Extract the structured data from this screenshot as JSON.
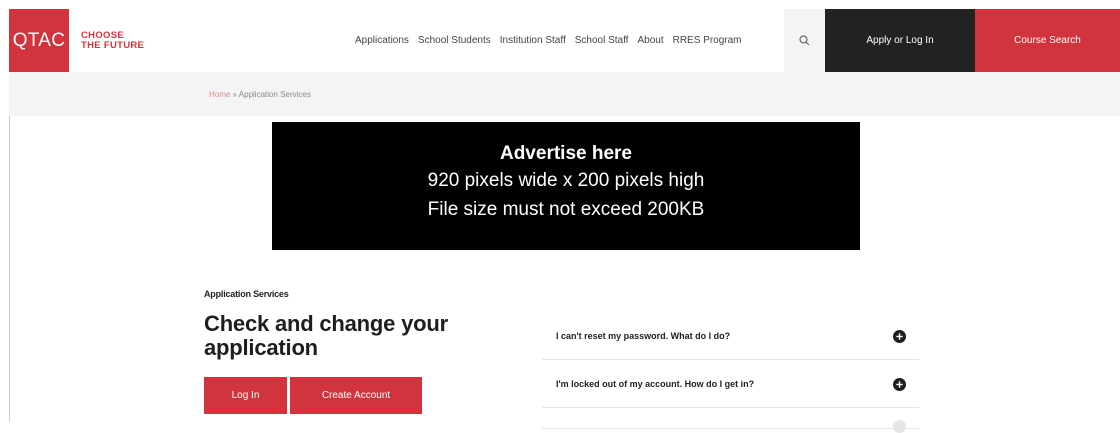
{
  "header": {
    "logo_text": "QTAC",
    "tagline_line1": "CHOOSE",
    "tagline_line2": "THE FUTURE",
    "nav": [
      {
        "label": "Applications"
      },
      {
        "label": "School Students"
      },
      {
        "label": "Institution Staff"
      },
      {
        "label": "School Staff"
      },
      {
        "label": "About"
      },
      {
        "label": "RRES Program"
      }
    ],
    "search_icon": "search-icon",
    "apply_label": "Apply or Log In",
    "course_search_label": "Course Search"
  },
  "breadcrumb": {
    "home": "Home",
    "separator": " » ",
    "current": "Application Services"
  },
  "ad": {
    "title": "Advertise here",
    "line1": "920 pixels wide x 200 pixels high",
    "line2": "File size must not exceed 200KB"
  },
  "content": {
    "section_label": "Application Services",
    "heading": "Check and change your application",
    "login_label": "Log In",
    "create_account_label": "Create Account"
  },
  "faq": [
    {
      "question": "I can't reset my password. What do I do?",
      "icon": "plus-circle-icon"
    },
    {
      "question": "I'm locked out of my account. How do I get in?",
      "icon": "plus-circle-icon"
    }
  ],
  "colors": {
    "brand_red": "#d2343e",
    "dark": "#222222",
    "crumb_bg": "#f4f4f4"
  }
}
